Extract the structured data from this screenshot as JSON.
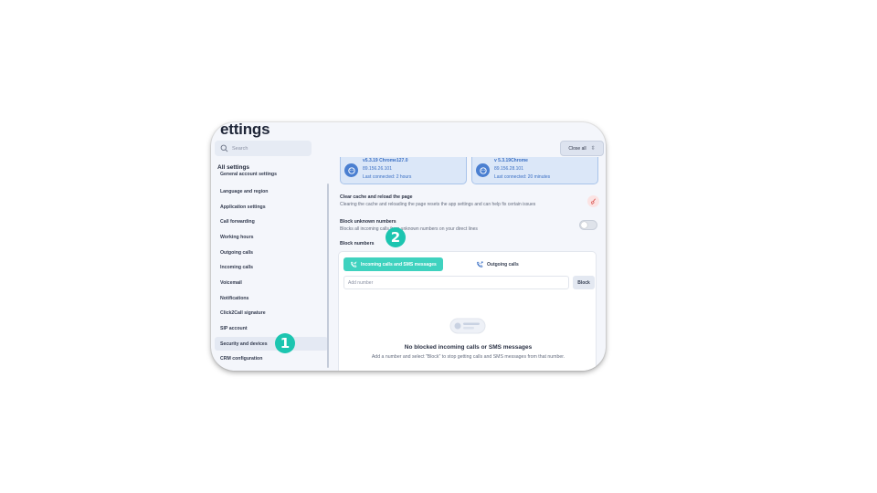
{
  "header": {
    "title": "ettings",
    "search_placeholder": "Search",
    "close_all_label": "Close all"
  },
  "sidebar": {
    "title": "All settings",
    "items": [
      {
        "label": "General account settings"
      },
      {
        "label": "Language and region"
      },
      {
        "label": "Application settings"
      },
      {
        "label": "Call forwarding"
      },
      {
        "label": "Working hours"
      },
      {
        "label": "Outgoing calls"
      },
      {
        "label": "Incoming calls"
      },
      {
        "label": "Voicemail"
      },
      {
        "label": "Notifications"
      },
      {
        "label": "Click2Call signature"
      },
      {
        "label": "SIP account"
      },
      {
        "label": "Security and devices",
        "active": true
      },
      {
        "label": "CRM configuration"
      }
    ]
  },
  "devices": [
    {
      "version": "v5.3.19 Chrome127.0",
      "ip": "89.156.26.101",
      "last_connected": "Last connected: 2 hours"
    },
    {
      "version": "v 5.3.19Chrome",
      "ip": "89.156.28.101",
      "last_connected": "Last connected: 20 minutes"
    }
  ],
  "cache": {
    "title": "Clear cache and reload the page",
    "description": "Clearing the cache and reloading the page resets the app settings and can help fix certain issues"
  },
  "block_unknown": {
    "title": "Block unknown numbers",
    "description": "Blocks all incoming calls from unknown numbers on your direct lines",
    "enabled": false
  },
  "block_numbers": {
    "title": "Block numbers",
    "tabs": [
      {
        "label": "Incoming calls and SMS messages",
        "active": true
      },
      {
        "label": "Outgoing calls",
        "active": false
      }
    ],
    "input_placeholder": "Add number",
    "block_button": "Block",
    "empty_title": "No blocked incoming calls or SMS messages",
    "empty_description": "Add a number and select \"Block\" to stop getting calls and SMS messages from that number."
  },
  "annotations": {
    "step1": "1",
    "step2": "2"
  },
  "colors": {
    "accent": "#3fd2bf",
    "badge": "#1cc5b0",
    "device_blue": "#3a6fc4"
  }
}
